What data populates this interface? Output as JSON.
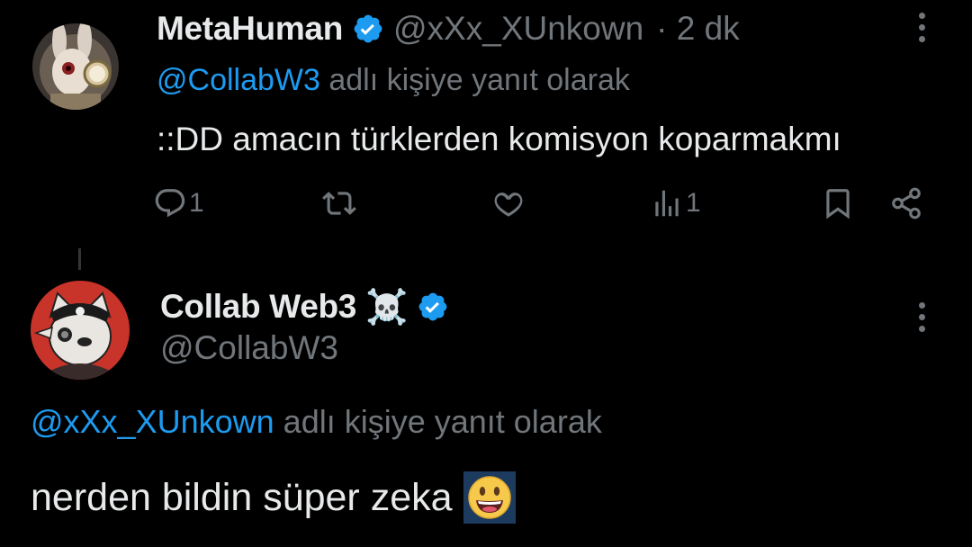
{
  "tweet1": {
    "author_name": "MetaHuman",
    "handle": "@xXx_XUnkown",
    "time": "· 2 dk",
    "reply_mention": "@CollabW3",
    "reply_suffix": "adlı kişiye yanıt olarak",
    "text": "::DD amacın türklerden komisyon koparmakmı",
    "actions": {
      "reply_count": "1",
      "retweet_count": "",
      "like_count": "",
      "views_count": "1"
    }
  },
  "tweet2": {
    "author_name": "Collab Web3",
    "name_emoji": "☠️",
    "handle": "@CollabW3",
    "reply_mention": "@xXx_XUnkown",
    "reply_suffix": "adlı kişiye yanıt olarak",
    "text": "nerden bildin süper zeka",
    "text_emoji": "😀"
  },
  "colors": {
    "background": "#000000",
    "primary_text": "#e7e9ea",
    "secondary_text": "#71767b",
    "accent": "#1d9bf0"
  },
  "icons": [
    "verified-badge-icon",
    "more-icon",
    "reply-icon",
    "retweet-icon",
    "like-icon",
    "views-icon",
    "bookmark-icon",
    "share-icon"
  ]
}
